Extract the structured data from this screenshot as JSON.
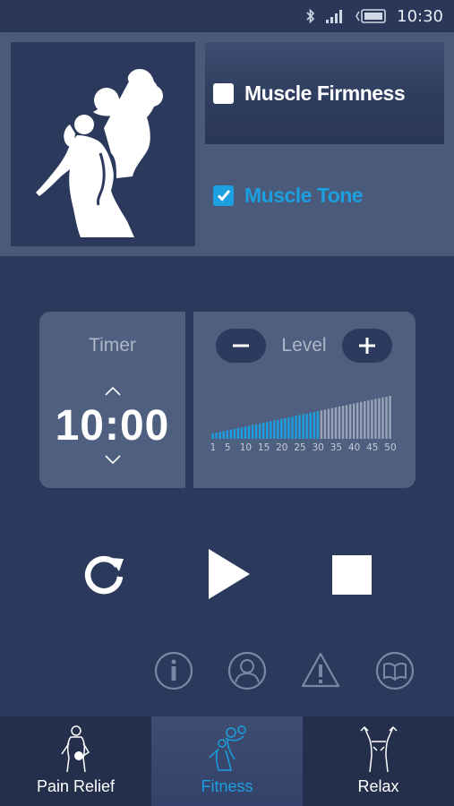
{
  "status_bar": {
    "time": "10:30"
  },
  "modes": [
    {
      "label": "Muscle Firmness",
      "checked": false
    },
    {
      "label": "Muscle Tone",
      "checked": true
    }
  ],
  "timer": {
    "label": "Timer",
    "value": "10:00"
  },
  "level": {
    "label": "Level",
    "value": 30,
    "max": 50,
    "ticks": [
      "1",
      "5",
      "10",
      "15",
      "20",
      "25",
      "30",
      "35",
      "40",
      "45",
      "50"
    ]
  },
  "playback": {
    "replay": "replay-icon",
    "play": "play-icon",
    "stop": "stop-icon"
  },
  "help_icons": [
    "info-icon",
    "user-icon",
    "warning-icon",
    "manual-icon"
  ],
  "nav": {
    "tabs": [
      {
        "label": "Pain Relief",
        "active": false
      },
      {
        "label": "Fitness",
        "active": true
      },
      {
        "label": "Relax",
        "active": false
      }
    ]
  },
  "colors": {
    "accent": "#1c9fe0",
    "background": "#2b3a5c",
    "panel": "#4a5a7b"
  }
}
